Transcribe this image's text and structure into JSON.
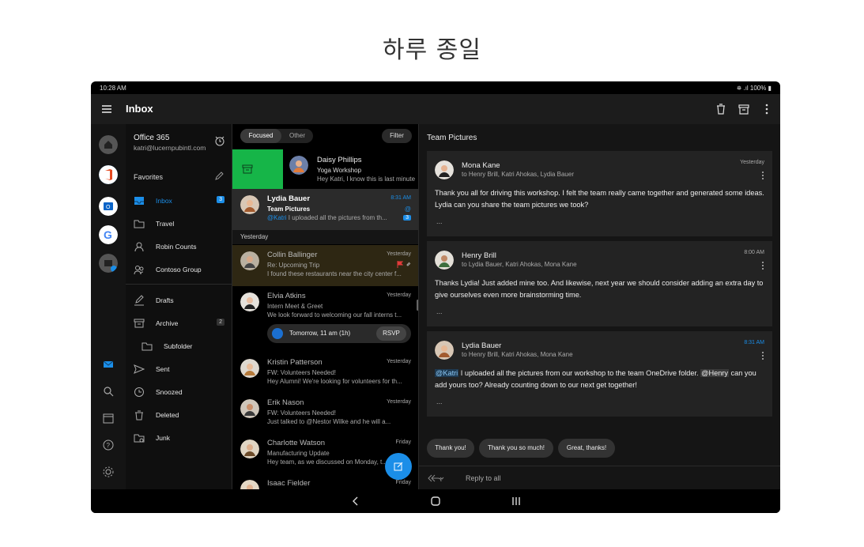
{
  "headline": "하루 종일",
  "status": {
    "time": "10:28 AM",
    "battery": "⛯ .ıl 100% ▮"
  },
  "appbar": {
    "title": "Inbox"
  },
  "account": {
    "name": "Office 365",
    "email": "katri@lucernpubintl.com"
  },
  "folders": {
    "favorites_label": "Favorites",
    "items": [
      {
        "label": "Inbox",
        "count": "3"
      },
      {
        "label": "Travel"
      },
      {
        "label": "Robin Counts"
      },
      {
        "label": "Contoso Group"
      },
      {
        "label": "Drafts"
      },
      {
        "label": "Archive",
        "count": "2"
      },
      {
        "label": "Subfolder"
      },
      {
        "label": "Sent"
      },
      {
        "label": "Snoozed"
      },
      {
        "label": "Deleted"
      },
      {
        "label": "Junk"
      }
    ]
  },
  "list": {
    "tab_focused": "Focused",
    "tab_other": "Other",
    "filter": "Filter",
    "yesterday": "Yesterday",
    "messages": [
      {
        "from": "Daisy Phillips",
        "subject": "Yoga Workshop",
        "preview": "Hey Katri, I know this is last minute",
        "time": ""
      },
      {
        "from": "Lydia Bauer",
        "subject": "Team Pictures",
        "mention": "@Katri",
        "preview": " I uploaded all the pictures from th...",
        "time": "8:31 AM",
        "count": "3",
        "at": "@"
      },
      {
        "from": "Collin Ballinger",
        "subject": "Re: Upcoming Trip",
        "preview": "I found these restaurants near the city center f...",
        "time": "Yesterday"
      },
      {
        "from": "Elvia Atkins",
        "subject": "Intern Meet & Greet",
        "preview": "We look forward to welcoming our fall interns t...",
        "time": "Yesterday",
        "rsvp_time": "Tomorrow, 11 am (1h)",
        "rsvp": "RSVP"
      },
      {
        "from": "Kristin Patterson",
        "subject": "FW: Volunteers Needed!",
        "preview": "Hey Alumni! We're looking for volunteers for th...",
        "time": "Yesterday"
      },
      {
        "from": "Erik Nason",
        "subject": "FW: Volunteers Needed!",
        "preview": "Just talked to @Nestor Wilke and he will a...",
        "time": "Yesterday"
      },
      {
        "from": "Charlotte Watson",
        "subject": "Manufacturing Update",
        "preview": "Hey team, as we discussed on Monday, t...",
        "time": "Friday"
      },
      {
        "from": "Isaac Fielder",
        "subject": "",
        "preview": "",
        "time": "Friday"
      }
    ]
  },
  "reading": {
    "title": "Team Pictures",
    "ellipsis": "...",
    "cards": [
      {
        "from": "Mona Kane",
        "to": "to Henry Brill, Katri Ahokas, Lydia Bauer",
        "time": "Yesterday",
        "body": "Thank you all for driving this workshop. I felt the team really came together and generated some ideas. Lydia can you share the team pictures we took?"
      },
      {
        "from": "Henry Brill",
        "to": "to Lydia Bauer, Katri Ahokas, Mona Kane",
        "time": "8:00 AM",
        "body": "Thanks Lydia! Just added mine too. And likewise, next year we should consider adding an extra day to give ourselves even more brainstorming time."
      },
      {
        "from": "Lydia Bauer",
        "to": "to Henry Brill, Katri Ahokas, Mona Kane",
        "time": "8:31 AM",
        "mention1": "@Katri",
        "body_a": " I uploaded all the pictures from our workshop to the team OneDrive folder. ",
        "mention2": "@Henry",
        "body_b": " can you add yours too? Already counting down to our next get together!"
      }
    ],
    "quick_replies": [
      "Thank you!",
      "Thank you so much!",
      "Great, thanks!"
    ],
    "reply_all": "Reply to all"
  },
  "colors": {
    "accent": "#1b8ee8",
    "swipe_green": "#16b548",
    "flag_red": "#e23a3a",
    "selected_bg": "#2b2b2b",
    "flagged_bg": "#2e2713"
  }
}
